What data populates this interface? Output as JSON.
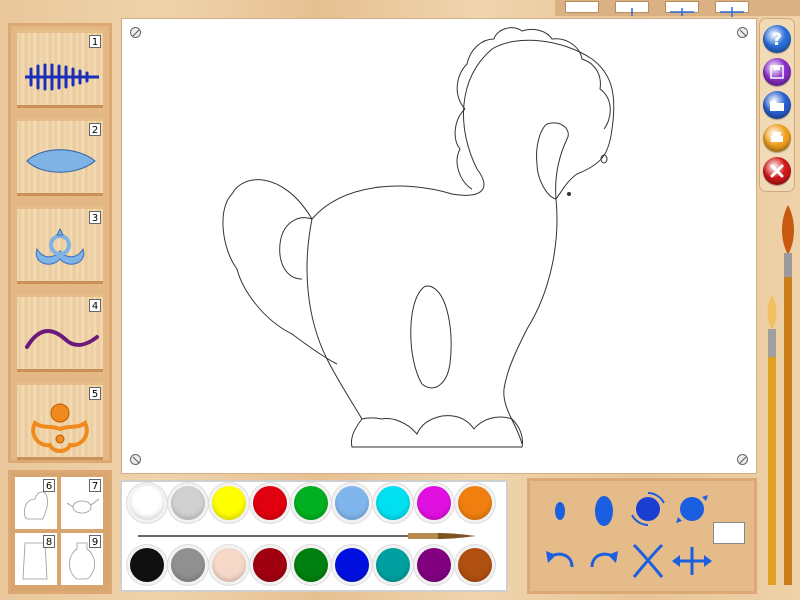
{
  "stencils": [
    {
      "number": "1",
      "icon": "fern-stencil-icon",
      "color": "#1a2fb8"
    },
    {
      "number": "2",
      "icon": "leaf-stencil-icon",
      "color": "#7fb3e6"
    },
    {
      "number": "3",
      "icon": "flower-stencil-icon",
      "color": "#7fb3e6"
    },
    {
      "number": "4",
      "icon": "wave-stencil-icon",
      "color": "#6a1a7a"
    },
    {
      "number": "5",
      "icon": "sun-flower-stencil-icon",
      "color": "#f0891e"
    }
  ],
  "templates": [
    {
      "number": "6",
      "icon": "horse-template-icon"
    },
    {
      "number": "7",
      "icon": "teapot-template-icon"
    },
    {
      "number": "8",
      "icon": "figure-template-icon"
    },
    {
      "number": "9",
      "icon": "vase-template-icon"
    }
  ],
  "palette": {
    "row1": [
      "#ffffff",
      "#d0d0d0",
      "#ffff00",
      "#e00010",
      "#00b020",
      "#7fb6ee",
      "#00e0f0",
      "#e010e0",
      "#f07f10"
    ],
    "row2": [
      "#101010",
      "#909090",
      "#f6d8c8",
      "#a00010",
      "#008010",
      "#0010e0",
      "#00a0a0",
      "#800080",
      "#b05010"
    ]
  },
  "tools": [
    {
      "name": "small-brush-tool",
      "icon": "small-drop-icon"
    },
    {
      "name": "medium-brush-tool",
      "icon": "medium-drop-icon"
    },
    {
      "name": "rotate-stamp-tool",
      "icon": "rotate-blob-icon"
    },
    {
      "name": "large-stamp-tool",
      "icon": "large-blob-icon"
    },
    {
      "name": "undo-tool",
      "icon": "undo-arrow-icon"
    },
    {
      "name": "redo-tool",
      "icon": "redo-arrow-icon"
    },
    {
      "name": "clear-tool",
      "icon": "cross-icon"
    },
    {
      "name": "move-tool",
      "icon": "move-arrows-icon"
    }
  ],
  "side_buttons": [
    {
      "name": "help-button",
      "icon": "question-icon",
      "color": "#2a6fd8"
    },
    {
      "name": "save-button",
      "icon": "floppy-icon",
      "color": "#8a2fc8"
    },
    {
      "name": "open-button",
      "icon": "folder-icon",
      "color": "#2a5fd0"
    },
    {
      "name": "print-button",
      "icon": "printer-icon",
      "color": "#f0a020"
    },
    {
      "name": "close-button",
      "icon": "close-icon",
      "color": "#d01818"
    }
  ],
  "top_tools": [
    "line-thin-icon",
    "line-cross-icon",
    "line-horizontal-icon",
    "line-plus-icon"
  ]
}
